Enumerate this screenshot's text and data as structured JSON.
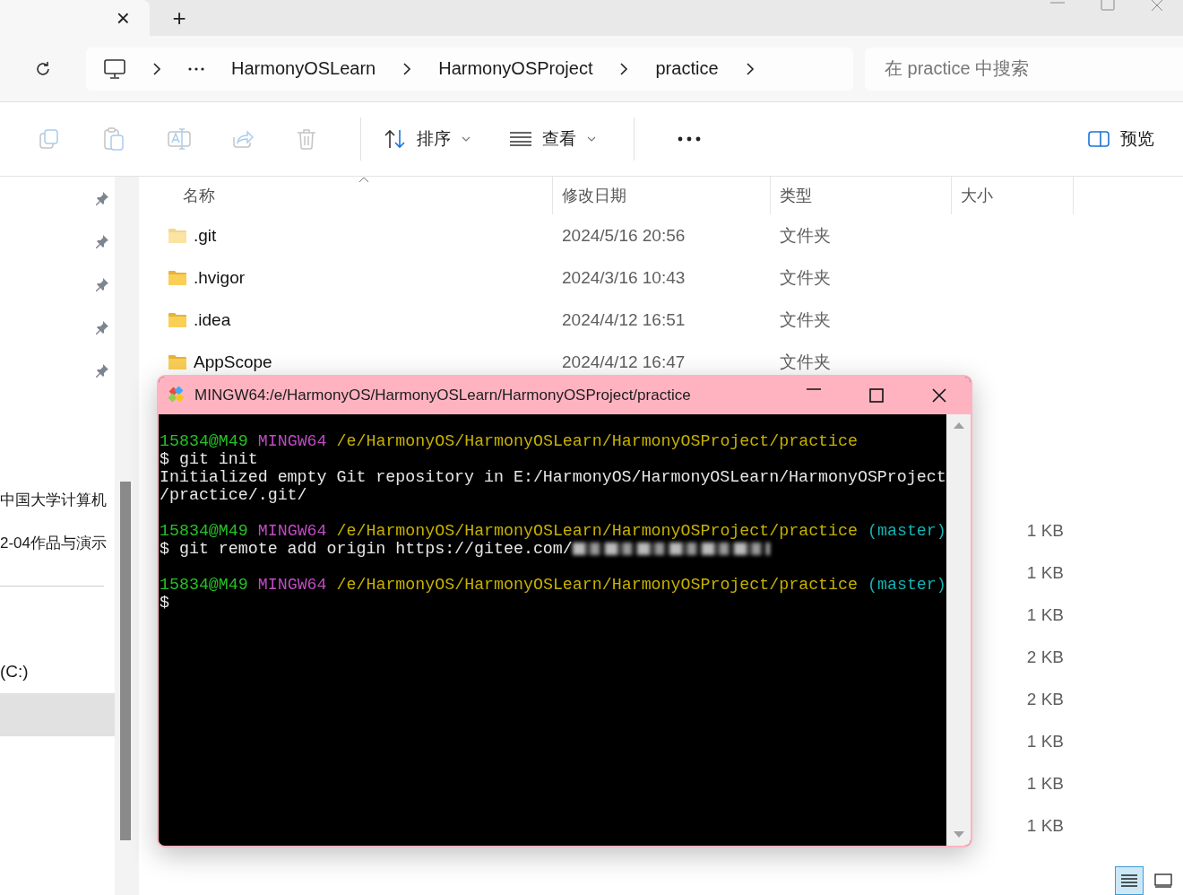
{
  "tab": {
    "close": "×"
  },
  "new_tab": "+",
  "breadcrumb": {
    "items": [
      "HarmonyOSLearn",
      "HarmonyOSProject",
      "practice"
    ]
  },
  "search": {
    "placeholder": "在 practice 中搜索"
  },
  "toolbar": {
    "actions": [
      {
        "kind": "copy",
        "disabled": true
      },
      {
        "kind": "paste",
        "disabled": true
      },
      {
        "kind": "rename",
        "disabled": true
      },
      {
        "kind": "share",
        "disabled": true
      },
      {
        "kind": "delete",
        "disabled": true
      }
    ],
    "sort": {
      "label": "排序"
    },
    "view": {
      "label": "查看"
    },
    "preview": {
      "label": "预览"
    }
  },
  "sidebar": {
    "pinned_items": [
      {
        "pinned": true
      },
      {
        "pinned": true
      },
      {
        "pinned": true
      },
      {
        "pinned": true
      },
      {
        "pinned": true
      }
    ],
    "items": [
      {
        "label": "中国大学计算机"
      },
      {
        "label": "2-04作品与演示"
      }
    ],
    "drives": [
      {
        "label": "(C:)",
        "selected": false
      },
      {
        "selected": true
      }
    ]
  },
  "table": {
    "columns": [
      "名称",
      "修改日期",
      "类型",
      "大小"
    ],
    "rows": [
      {
        "name": ".git",
        "date": "2024/5/16 20:56",
        "type": "文件夹",
        "hidden": true
      },
      {
        "name": ".hvigor",
        "date": "2024/3/16 10:43",
        "type": "文件夹",
        "hidden": false
      },
      {
        "name": ".idea",
        "date": "2024/4/12 16:51",
        "type": "文件夹",
        "hidden": false
      },
      {
        "name": "AppScope",
        "date": "2024/4/12 16:47",
        "type": "文件夹",
        "hidden": false
      }
    ],
    "sizes": [
      "1 KB",
      "1 KB",
      "1 KB",
      "2 KB",
      "2 KB",
      "1 KB",
      "1 KB",
      "1 KB"
    ]
  },
  "view_buttons": [
    {
      "kind": "details",
      "selected": true
    },
    {
      "kind": "tiles",
      "selected": false
    }
  ],
  "terminal": {
    "title": "MINGW64:/e/HarmonyOS/HarmonyOSLearn/HarmonyOSProject/practice",
    "lines": [
      {
        "kind": "text",
        "segments": [
          {
            "kind": "user",
            "text": "15834@M49"
          },
          {
            "kind": "host",
            "text": "MINGW64"
          },
          {
            "kind": "path",
            "text": "/e/HarmonyOS/HarmonyOSLearn/HarmonyOSProject/practice"
          }
        ]
      },
      {
        "kind": "text",
        "segments": [
          {
            "kind": "plain",
            "text": "$ git init"
          }
        ]
      },
      {
        "kind": "text",
        "segments": [
          {
            "kind": "plain",
            "text": "Initialized empty Git repository in E:/HarmonyOS/HarmonyOSLearn/HarmonyOSProject"
          }
        ]
      },
      {
        "kind": "text",
        "segments": [
          {
            "kind": "plain",
            "text": "/practice/.git/"
          }
        ]
      },
      {
        "kind": "blank"
      },
      {
        "kind": "text",
        "segments": [
          {
            "kind": "user",
            "text": "15834@M49"
          },
          {
            "kind": "host",
            "text": "MINGW64"
          },
          {
            "kind": "path",
            "text": "/e/HarmonyOS/HarmonyOSLearn/HarmonyOSProject/practice"
          },
          {
            "kind": "branch",
            "text": "(master)"
          }
        ]
      },
      {
        "kind": "text",
        "segments": [
          {
            "kind": "plain",
            "text": "$ git remote add origin https://gitee.com/"
          },
          {
            "kind": "redacted"
          }
        ]
      },
      {
        "kind": "blank"
      },
      {
        "kind": "text",
        "segments": [
          {
            "kind": "user",
            "text": "15834@M49"
          },
          {
            "kind": "host",
            "text": "MINGW64"
          },
          {
            "kind": "path",
            "text": "/e/HarmonyOS/HarmonyOSLearn/HarmonyOSProject/practice"
          },
          {
            "kind": "branch",
            "text": "(master)"
          }
        ]
      },
      {
        "kind": "text",
        "segments": [
          {
            "kind": "plain",
            "text": "$"
          }
        ]
      }
    ]
  }
}
